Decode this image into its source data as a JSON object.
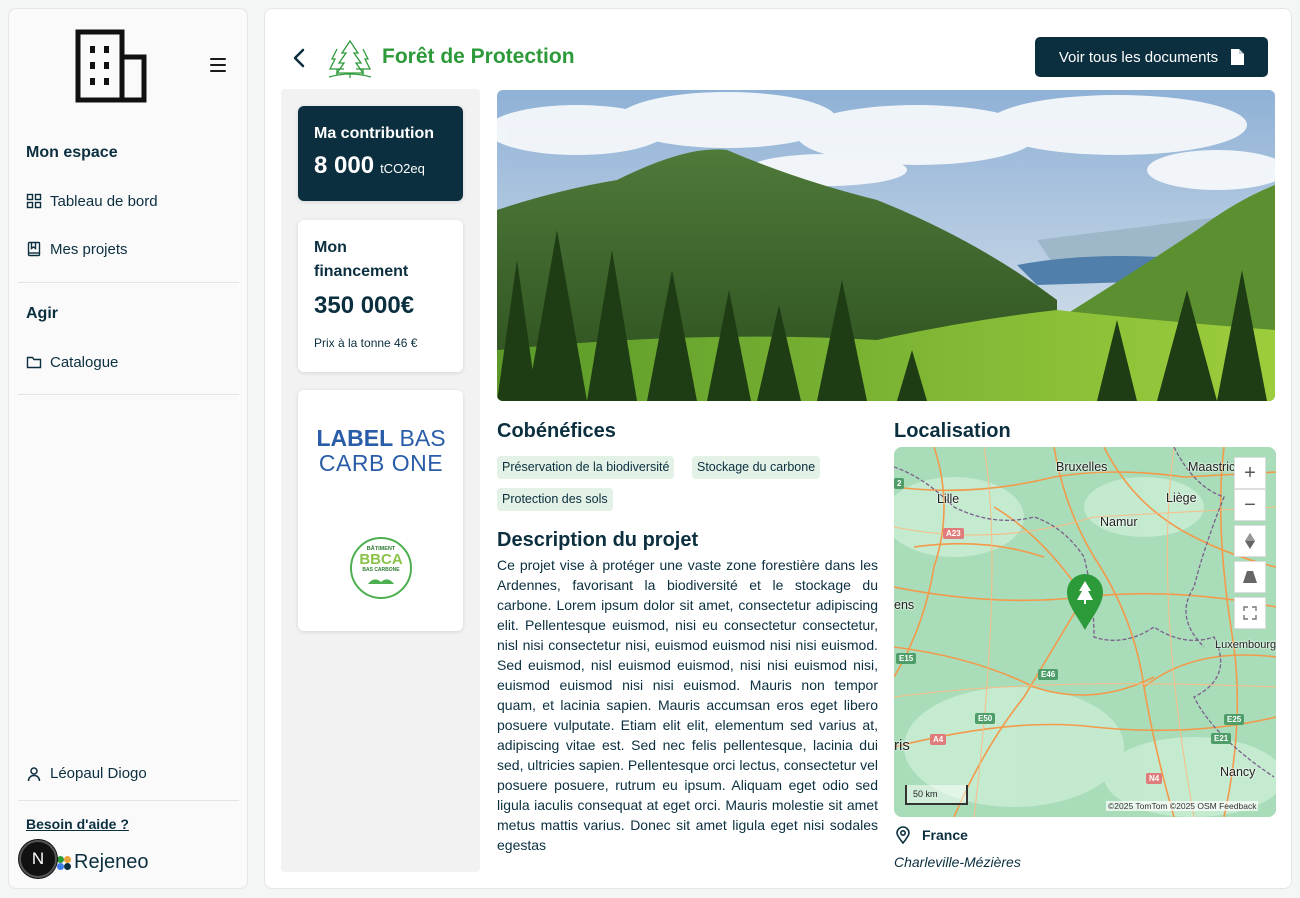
{
  "sidebar": {
    "menu_title_1": "Mon espace",
    "items_1": [
      {
        "label": "Tableau de bord",
        "icon": "dashboard-icon"
      },
      {
        "label": "Mes projets",
        "icon": "book-icon"
      }
    ],
    "menu_title_2": "Agir",
    "items_2": [
      {
        "label": "Catalogue",
        "icon": "folder-icon"
      }
    ],
    "user_name": "Léopaul Diogo",
    "help_label": "Besoin d'aide ?",
    "brand_name": "Rejeneo",
    "badge_letter": "N"
  },
  "header": {
    "title": "Forêt de Protection",
    "docs_button_label": "Voir tous les documents"
  },
  "contribution": {
    "label": "Ma contribution",
    "value": "8 000",
    "unit": "tCO2eq"
  },
  "financing": {
    "label": "Mon financement",
    "value": "350 000€",
    "price_label": "Prix à la tonne 46 €"
  },
  "labels": {
    "label_bas_carbone_line1_a": "LABEL",
    "label_bas_carbone_line1_b": "BAS",
    "label_bas_carbone_line2": "CARB ONE",
    "bbca_top": "BÂTIMENT",
    "bbca_main": "BBCA",
    "bbca_sub": "BAS CARBONE"
  },
  "cobenefits": {
    "title": "Cobénéfices",
    "tags": [
      "Préservation de la biodiversité",
      "Stockage du carbone",
      "Protection des sols"
    ]
  },
  "description": {
    "title": "Description du projet",
    "text": "Ce projet vise à protéger une vaste zone forestière dans les Ardennes, favorisant la biodiversité et le stockage du carbone. Lorem ipsum dolor sit amet, consectetur adipiscing elit. Pellentesque euismod, nisi eu consectetur consectetur, nisl nisi consectetur nisi, euismod euismod nisi nisi euismod. Sed euismod, nisl euismod euismod, nisi nisi euismod nisi, euismod euismod nisi nisi euismod. Mauris non tempor quam, et lacinia sapien. Mauris accumsan eros eget libero posuere vulputate. Etiam elit elit, elementum sed varius at, adipiscing vitae est. Sed nec felis pellentesque, lacinia dui sed, ultricies sapien. Pellentesque orci lectus, consectetur vel posuere posuere, rutrum eu ipsum. Aliquam eget odio sed ligula iaculis consequat at eget orci. Mauris molestie sit amet metus mattis varius. Donec sit amet ligula eget nisi sodales egestas"
  },
  "location": {
    "title": "Localisation",
    "country": "France",
    "city": "Charleville-Mézières",
    "map_labels": [
      "Bruxelles",
      "Maastricht",
      "Lille",
      "Liège",
      "Namur",
      "ens",
      "Luxembourg",
      "ris",
      "Nancy"
    ],
    "road_badges": [
      "A23",
      "E15",
      "E46",
      "E50",
      "A4",
      "E25",
      "E21",
      "N4",
      "2"
    ],
    "scale_label": "50 km",
    "attribution": "©2025 TomTom  ©2025 OSM  Feedback",
    "zoom_in": "+",
    "zoom_out": "−"
  },
  "colors": {
    "primary": "#0b2f3f",
    "accent_green": "#2d9a3a",
    "tag_bg": "#e3f1e6",
    "map_green": "#a7dcb9"
  }
}
